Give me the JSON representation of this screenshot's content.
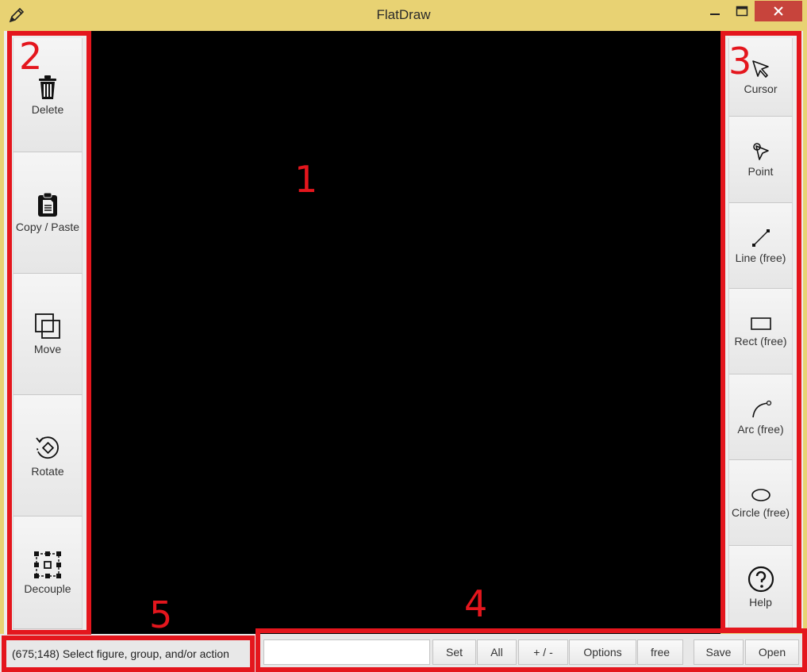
{
  "window": {
    "title": "FlatDraw",
    "icons": {
      "app": "pencil-icon",
      "minimize": "minimize-icon",
      "maximize": "maximize-icon",
      "close": "close-icon"
    },
    "close_color": "#c7443c",
    "frame_color": "#e8d273"
  },
  "left_tools": [
    {
      "label": "Delete",
      "icon": "trash-icon"
    },
    {
      "label": "Copy / Paste",
      "icon": "clipboard-icon"
    },
    {
      "label": "Move",
      "icon": "move-icon"
    },
    {
      "label": "Rotate",
      "icon": "rotate-icon"
    },
    {
      "label": "Decouple",
      "icon": "decouple-icon"
    }
  ],
  "right_tools": [
    {
      "label": "Cursor",
      "icon": "cursor-icon"
    },
    {
      "label": "Point",
      "icon": "point-icon"
    },
    {
      "label": "Line (free)",
      "icon": "line-icon"
    },
    {
      "label": "Rect (free)",
      "icon": "rect-icon"
    },
    {
      "label": "Arc (free)",
      "icon": "arc-icon"
    },
    {
      "label": "Circle (free)",
      "icon": "circle-icon"
    },
    {
      "label": "Help",
      "icon": "help-icon"
    }
  ],
  "canvas": {
    "background": "#000000"
  },
  "status": {
    "text": "(675;148)  Select figure, group, and/or action",
    "input_value": "",
    "buttons": {
      "set": "Set",
      "all": "All",
      "plus_minus": "+ / -",
      "options": "Options",
      "free": "free",
      "save": "Save",
      "open": "Open"
    }
  },
  "annotations": {
    "color": "#e4161d",
    "labels": [
      "1",
      "2",
      "3",
      "4",
      "5"
    ]
  }
}
